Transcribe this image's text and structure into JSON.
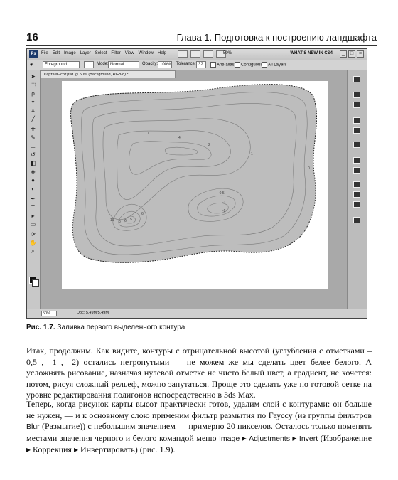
{
  "page": {
    "number": "16",
    "chapter_title": "Глава 1. Подготовка к построению ландшафта"
  },
  "screenshot": {
    "menu_items": [
      "File",
      "Edit",
      "Image",
      "Layer",
      "Select",
      "Filter",
      "View",
      "Window",
      "Help"
    ],
    "zoom_select": "50%",
    "workspace_label": "WHAT'S NEW IN CS4",
    "options": {
      "fill_source": "Foreground",
      "mode_label": "Mode:",
      "mode_value": "Normal",
      "opacity_label": "Opacity:",
      "opacity_value": "100%",
      "tolerance_label": "Tolerance:",
      "tolerance_value": "32",
      "antialias": "Anti-alias",
      "contiguous": "Contiguous",
      "all_layers": "All Layers"
    },
    "document_tab": "Карта высот.psd @ 50% (Background, RGB/8) *",
    "contour_labels": [
      "7",
      "4",
      "2",
      "1",
      "0",
      "-0.5",
      "-1",
      "-2",
      "10",
      "8",
      "6",
      "5",
      "6"
    ],
    "status_zoom": "50%",
    "status_doc": "Doc: 5,49M/5,49M",
    "window_controls": [
      "_",
      "□",
      "×"
    ]
  },
  "caption": {
    "label": "Рис. 1.7.",
    "text": "Заливка первого выделенного контура"
  },
  "body": {
    "p1": "Итак, продолжим. Как видите, контуры с отрицательной высотой (углубления с отметками –0,5 , –1 , –2) остались нетронутыми — не можем же мы сделать цвет белее белого. А усложнять рисование, назначая нулевой отметке не чисто белый цвет, а градиент, не хочется: потом, рисуя сложный рельеф, можно запутаться. Проще это сделать уже по готовой сетке на уровне редактирования полигонов непосредственно в 3ds Max.",
    "p2_a": "Теперь, когда рисунок карты высот практически готов, удалим слой с контурами: он больше не нужен, — и к основному слою применим фильтр размытия по Гауссу (из группы фильтров ",
    "p2_blur": "Blur",
    "p2_b": " (Размытие)) с небольшим значением — примерно 20 пикселов. Осталось только поменять местами значения черного и белого командой меню ",
    "p2_image": "Image",
    "p2_adj": "Adjustments",
    "p2_invert": "Invert",
    "p2_c": " (Изображение ▸ Коррекция ▸ Инвертировать) (рис. 1.9).",
    "arrow": "▸"
  }
}
